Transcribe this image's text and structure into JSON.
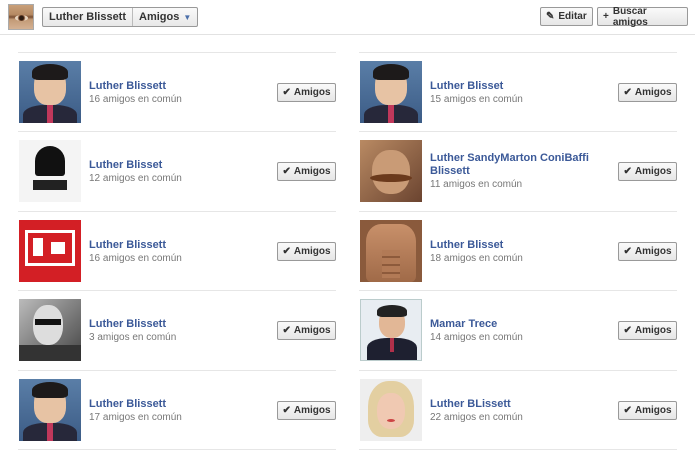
{
  "header": {
    "profile_name": "Luther Blissett",
    "section": "Amigos",
    "edit_label": "Editar",
    "find_label": "Buscar amigos"
  },
  "friend_button_label": "Amigos",
  "friends_left": [
    {
      "name": "Luther Blissett",
      "mutual": "16 amigos en común",
      "avatar": "man-portrait"
    },
    {
      "name": "Luther Blisset",
      "mutual": "12 amigos en común",
      "avatar": "star-wars-vader"
    },
    {
      "name": "Luther Blissett",
      "mutual": "16 amigos en común",
      "avatar": "red-warning-sign"
    },
    {
      "name": "Luther Blissett",
      "mutual": "3 amigos en común",
      "avatar": "bw-man-glasses"
    },
    {
      "name": "Luther Blissett",
      "mutual": "17 amigos en común",
      "avatar": "man-portrait"
    }
  ],
  "friends_right": [
    {
      "name": "Luther Blisset",
      "mutual": "15 amigos en común",
      "avatar": "man-portrait"
    },
    {
      "name": "Luther SandyMarton ConiBaffi Blissett",
      "mutual": "11 amigos en común",
      "avatar": "mustache-man"
    },
    {
      "name": "Luther Blisset",
      "mutual": "18 amigos en común",
      "avatar": "torso"
    },
    {
      "name": "Mamar Trece",
      "mutual": "14 amigos en común",
      "avatar": "man-suit"
    },
    {
      "name": "Luther BLissett",
      "mutual": "22 amigos en común",
      "avatar": "blonde-portrait"
    }
  ]
}
